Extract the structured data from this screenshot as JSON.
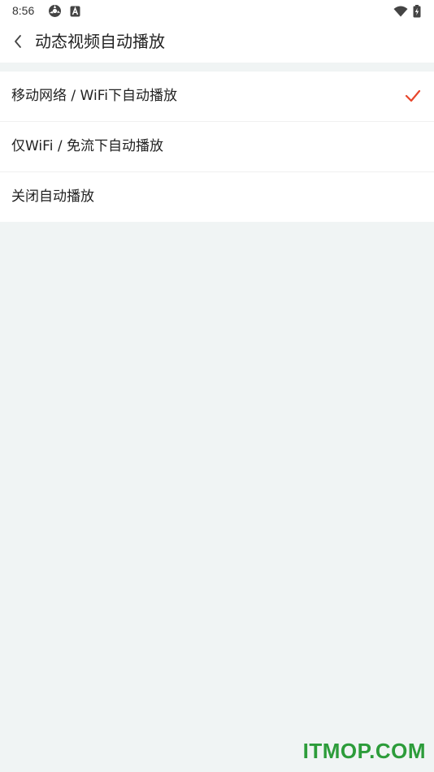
{
  "status_bar": {
    "time": "8:56",
    "icons": [
      "settings-gear-icon",
      "a-badge-icon",
      "wifi-icon",
      "battery-charging-icon"
    ]
  },
  "header": {
    "title": "动态视频自动播放",
    "back_icon": "chevron-left-icon"
  },
  "options": [
    {
      "label": "移动网络 / WiFi下自动播放",
      "selected": true
    },
    {
      "label": "仅WiFi / 免流下自动播放",
      "selected": false
    },
    {
      "label": "关闭自动播放",
      "selected": false
    }
  ],
  "colors": {
    "accent": "#e8462c",
    "background": "#f0f4f4",
    "watermark": "#2c9c3a"
  },
  "watermark": "ITMOP.COM"
}
